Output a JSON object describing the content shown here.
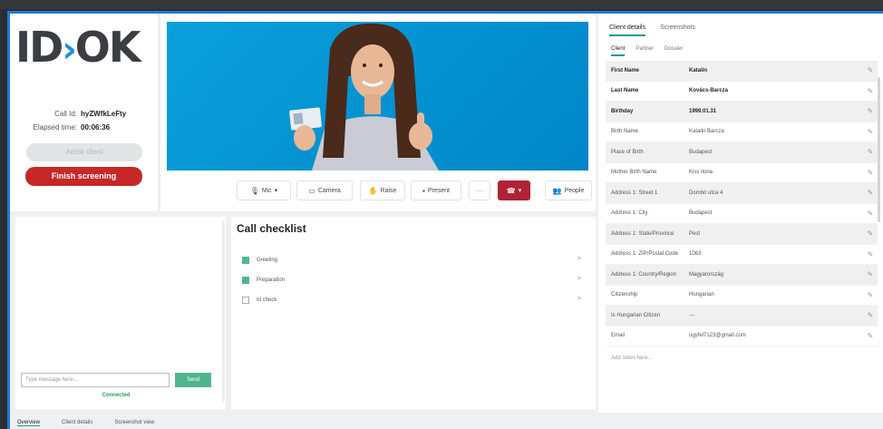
{
  "logo": {
    "left": "ID",
    "chevron": "›",
    "right": "OK"
  },
  "call": {
    "id_label": "Call Id:",
    "id_value": "hyZWfkLeFty",
    "elapsed_label": "Elapsed time:",
    "elapsed_value": "00:06:36",
    "admit_label": "Admit client",
    "finish_label": "Finish screening"
  },
  "controls": {
    "mic": "Mic",
    "camera": "Camera",
    "raise": "Raise",
    "present": "Present",
    "more": "···",
    "end": "▾",
    "people": "People"
  },
  "details": {
    "tabs": [
      "Client details",
      "Screenshots"
    ],
    "subtabs": [
      "Client",
      "Partner",
      "Dossier"
    ],
    "rows": [
      {
        "key": "First Name",
        "value": "Katalin",
        "bold": true
      },
      {
        "key": "Last Name",
        "value": "Kovács-Barcza",
        "bold": true
      },
      {
        "key": "Birthday",
        "value": "1999.01.31",
        "bold": true
      },
      {
        "key": "Birth Name",
        "value": "Katalin Barcza",
        "bold": false
      },
      {
        "key": "Place of Birth",
        "value": "Budapest",
        "bold": false
      },
      {
        "key": "Mother Birth Name",
        "value": "Kiss Ilona",
        "bold": false
      },
      {
        "key": "Address 1: Street 1",
        "value": "Dombó utca 4",
        "bold": false
      },
      {
        "key": "Address 1: City",
        "value": "Budapest",
        "bold": false
      },
      {
        "key": "Address 1: State/Province",
        "value": "Pest",
        "bold": false
      },
      {
        "key": "Address 1: ZIP/Postal Code",
        "value": "1063",
        "bold": false
      },
      {
        "key": "Address 1: Country/Region",
        "value": "Magyarország",
        "bold": false
      },
      {
        "key": "Citizenship",
        "value": "Hungarian",
        "bold": false
      },
      {
        "key": "Is Hungarian Citizen",
        "value": "---",
        "bold": false
      },
      {
        "key": "Email",
        "value": "ugyfel7123@gmail.com",
        "bold": false
      }
    ],
    "notes_placeholder": "Add notes here..."
  },
  "chat": {
    "placeholder": "Type message here...",
    "send": "Send",
    "status": "Connected"
  },
  "checklist": {
    "title": "Call checklist",
    "items": [
      {
        "label": "Greeting",
        "checked": true
      },
      {
        "label": "Preparation",
        "checked": true
      },
      {
        "label": "Id check",
        "checked": false
      }
    ]
  },
  "bottom_tabs": [
    "Overview",
    "Client details",
    "Screenshot view"
  ],
  "colors": {
    "accent": "#1a9c8c",
    "danger": "#c62828",
    "video_bg": "#0aa0dc",
    "send": "#4fb58f"
  }
}
